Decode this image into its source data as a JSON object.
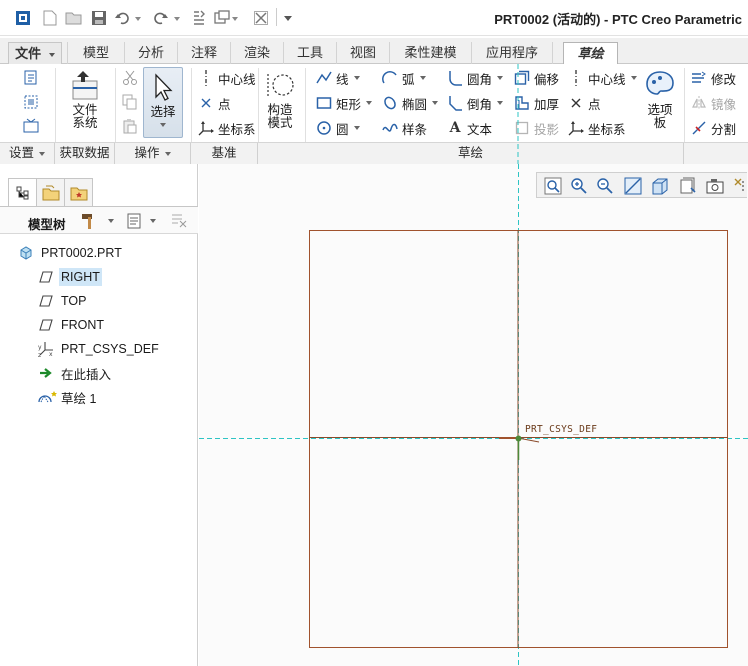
{
  "window": {
    "title": "PRT0002 (活动的) - PTC Creo Parametric"
  },
  "quick_access": {
    "icons": [
      "app-icon",
      "new-icon",
      "open-icon",
      "save-icon",
      "undo-icon",
      "redo-icon",
      "regenerate-icon",
      "windows-icon",
      "close-window-icon",
      "customize-icon"
    ]
  },
  "tabs": [
    {
      "label": "文件",
      "has_dropdown": true
    },
    {
      "label": "模型"
    },
    {
      "label": "分析"
    },
    {
      "label": "注释"
    },
    {
      "label": "渲染"
    },
    {
      "label": "工具"
    },
    {
      "label": "视图"
    },
    {
      "label": "柔性建模"
    },
    {
      "label": "应用程序"
    },
    {
      "label": "草绘",
      "active": true
    }
  ],
  "ribbon": {
    "get_data": {
      "file_system_line1": "文件",
      "file_system_line2": "系统"
    },
    "operations": {
      "select": "选择"
    },
    "datum": {
      "centerline": "中心线",
      "point": "点",
      "csys": "坐标系"
    },
    "construction": {
      "line1": "构造",
      "line2": "模式"
    },
    "sketch": {
      "line": "线",
      "rectangle": "矩形",
      "circle": "圆",
      "arc": "弧",
      "ellipse": "椭圆",
      "spline": "样条",
      "fillet": "圆角",
      "chamfer": "倒角",
      "text": "文本",
      "offset": "偏移",
      "thicken": "加厚",
      "project": "投影",
      "centerline": "中心线",
      "point": "点",
      "csys": "坐标系",
      "palette_line1": "选项",
      "palette_line2": "板"
    },
    "editing": {
      "modify": "修改",
      "mirror": "镜像",
      "divide": "分割"
    },
    "groups": [
      {
        "label": "设置",
        "has_dropdown": true
      },
      {
        "label": "获取数据"
      },
      {
        "label": "操作",
        "has_dropdown": true
      },
      {
        "label": "基准"
      },
      {
        "label": "草绘"
      }
    ]
  },
  "model_tree": {
    "toolbar_label": "模型树",
    "items": [
      {
        "label": "PRT0002.PRT",
        "icon": "part-icon"
      },
      {
        "label": "RIGHT",
        "icon": "datum-plane-icon",
        "selected": true
      },
      {
        "label": "TOP",
        "icon": "datum-plane-icon"
      },
      {
        "label": "FRONT",
        "icon": "datum-plane-icon"
      },
      {
        "label": "PRT_CSYS_DEF",
        "icon": "csys-icon"
      },
      {
        "label": "在此插入",
        "icon": "insert-here-icon"
      },
      {
        "label": "草绘 1",
        "icon": "sketch-icon"
      }
    ]
  },
  "graphics": {
    "csys_label": "PRT_CSYS_DEF",
    "colors": {
      "datum_plane": "#a0522d",
      "centerline": "#2ec4c4",
      "csys": "#4c8a3a",
      "highlight": "#cfe6f7"
    }
  }
}
